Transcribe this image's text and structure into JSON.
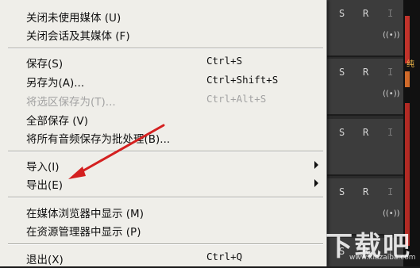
{
  "menu": {
    "items": [
      {
        "label": "关闭未使用媒体 (U)",
        "shortcut": "",
        "disabled": false,
        "submenu": false
      },
      {
        "label": "关闭会话及其媒体 (F)",
        "shortcut": "",
        "disabled": false,
        "submenu": false
      },
      {
        "label": "保存(S)",
        "shortcut": "Ctrl+S",
        "disabled": false,
        "submenu": false
      },
      {
        "label": "另存为(A)...",
        "shortcut": "Ctrl+Shift+S",
        "disabled": false,
        "submenu": false
      },
      {
        "label": "将选区保存为(T)...",
        "shortcut": "Ctrl+Alt+S",
        "disabled": true,
        "submenu": false
      },
      {
        "label": "全部保存 (V)",
        "shortcut": "",
        "disabled": false,
        "submenu": false
      },
      {
        "label": "将所有音频保存为批处理(B)...",
        "shortcut": "",
        "disabled": false,
        "submenu": false
      },
      {
        "label": "导入(I)",
        "shortcut": "",
        "disabled": false,
        "submenu": true
      },
      {
        "label": "导出(E)",
        "shortcut": "",
        "disabled": false,
        "submenu": true
      },
      {
        "label": "在媒体浏览器中显示 (M)",
        "shortcut": "",
        "disabled": false,
        "submenu": false
      },
      {
        "label": "在资源管理器中显示 (P)",
        "shortcut": "",
        "disabled": false,
        "submenu": false
      },
      {
        "label": "退出(X)",
        "shortcut": "Ctrl+Q",
        "disabled": false,
        "submenu": false
      }
    ]
  },
  "tracks": {
    "buttons": [
      "S",
      "R",
      "I"
    ],
    "wave_icon": "((•))"
  },
  "side_label": "纯",
  "watermark": {
    "logo": "下载吧",
    "url": "www.xiazaiba.com"
  },
  "colors": {
    "menu_bg": "#efeee9",
    "disabled_text": "#a3a3a3",
    "annotation": "#d42020"
  }
}
